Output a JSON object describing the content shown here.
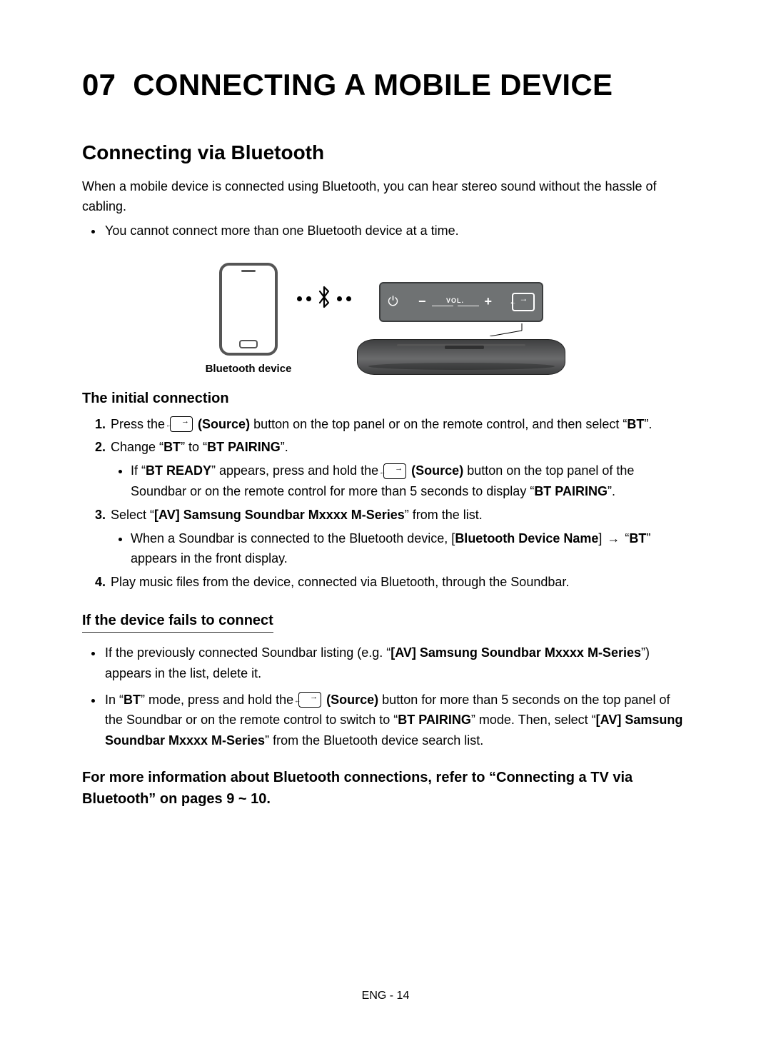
{
  "chapter": {
    "number": "07",
    "title": "CONNECTING A MOBILE DEVICE"
  },
  "section_title": "Connecting via Bluetooth",
  "intro": "When a mobile device is connected using Bluetooth, you can hear stereo sound without the hassle of cabling.",
  "top_bullet": "You cannot connect more than one Bluetooth device at a time.",
  "diagram": {
    "caption": "Bluetooth device",
    "panel_vol_label": "VOL.",
    "panel_minus": "−",
    "panel_plus": "+",
    "power_glyph": "⏻",
    "bt_glyph": "฿"
  },
  "initial_heading": "The initial connection",
  "steps": {
    "s1_a": "Press the ",
    "s1_b": " (Source)",
    "s1_c": " button on the top panel or on the remote control, and then select “",
    "s1_d": "BT",
    "s1_e": "”.",
    "s2_a": "Change “",
    "s2_b": "BT",
    "s2_c": "” to “",
    "s2_d": "BT PAIRING",
    "s2_e": "”.",
    "s2_sub_a": "If “",
    "s2_sub_b": "BT READY",
    "s2_sub_c": "” appears, press and hold the ",
    "s2_sub_d": " (Source)",
    "s2_sub_e": " button on the top panel of the Soundbar or on the remote control for more than 5 seconds to display “",
    "s2_sub_f": "BT PAIRING",
    "s2_sub_g": "”.",
    "s3_a": "Select “",
    "s3_b": "[AV] Samsung Soundbar Mxxxx M-Series",
    "s3_c": "” from the list.",
    "s3_sub_a": "When a Soundbar is connected to the Bluetooth device, [",
    "s3_sub_b": "Bluetooth Device Name",
    "s3_sub_c": "] ",
    "s3_sub_arrow": "→",
    "s3_sub_d": " “",
    "s3_sub_e": "BT",
    "s3_sub_f": "” appears in the front display.",
    "s4": "Play music files from the device, connected via Bluetooth, through the Soundbar."
  },
  "fails_heading": "If the device fails to connect",
  "fails": {
    "f1_a": "If the previously connected Soundbar listing (e.g. “",
    "f1_b": "[AV] Samsung Soundbar Mxxxx M-Series",
    "f1_c": "”) appears in the list, delete it.",
    "f2_a": "In “",
    "f2_b": "BT",
    "f2_c": "” mode, press and hold the ",
    "f2_d": " (Source)",
    "f2_e": " button for more than 5 seconds on the top panel of the Soundbar or on the remote control to switch to “",
    "f2_f": "BT PAIRING",
    "f2_g": "” mode. Then, select “",
    "f2_h": "[AV] Samsung Soundbar Mxxxx M-Series",
    "f2_i": "” from the Bluetooth device search list."
  },
  "more_info": "For more information about Bluetooth connections, refer to “Connecting a TV via Bluetooth” on pages 9 ~ 10.",
  "footer": "ENG - 14"
}
